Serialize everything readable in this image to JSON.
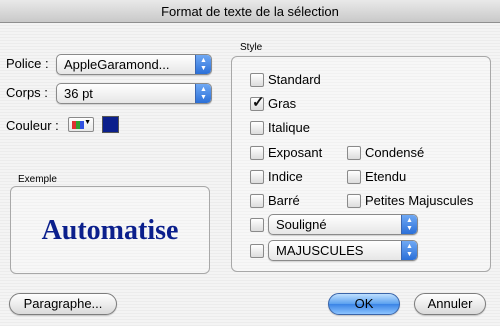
{
  "window": {
    "title": "Format de texte  de la sélection"
  },
  "font": {
    "label": "Police :",
    "value": "AppleGaramond..."
  },
  "size": {
    "label": "Corps :",
    "value": "36 pt"
  },
  "color": {
    "label": "Couleur :",
    "selected": "#0b1f8c"
  },
  "preview": {
    "label": "Exemple",
    "text": "Automatise"
  },
  "style": {
    "label": "Style",
    "options": {
      "standard": {
        "label": "Standard",
        "checked": false
      },
      "gras": {
        "label": "Gras",
        "checked": true
      },
      "italique": {
        "label": "Italique",
        "checked": false
      },
      "exposant": {
        "label": "Exposant",
        "checked": false
      },
      "condense": {
        "label": "Condensé",
        "checked": false
      },
      "indice": {
        "label": "Indice",
        "checked": false
      },
      "etendu": {
        "label": "Etendu",
        "checked": false
      },
      "barre": {
        "label": "Barré",
        "checked": false
      },
      "petites_majuscules": {
        "label": "Petites Majuscules",
        "checked": false
      }
    },
    "underline": {
      "checked": false,
      "value": "Souligné"
    },
    "case": {
      "checked": false,
      "value": "MAJUSCULES"
    }
  },
  "buttons": {
    "paragraph": "Paragraphe...",
    "ok": "OK",
    "cancel": "Annuler"
  }
}
